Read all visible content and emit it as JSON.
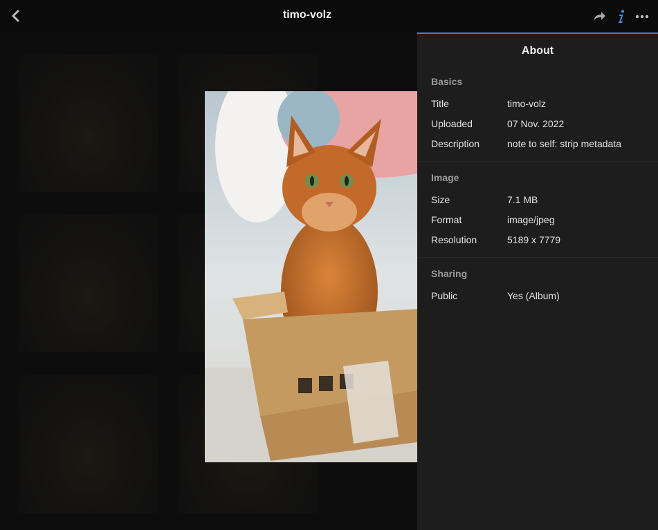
{
  "header": {
    "title": "timo-volz",
    "back_icon": "chevron-left-icon",
    "share_icon": "share-arrow-icon",
    "info_icon": "info-icon",
    "more_icon": "more-horizontal-icon"
  },
  "photo": {
    "subject": "orange cat sitting in cardboard box"
  },
  "panel": {
    "title": "About",
    "sections": [
      {
        "title": "Basics",
        "rows": [
          {
            "key": "Title",
            "value": "timo-volz"
          },
          {
            "key": "Uploaded",
            "value": "07 Nov. 2022"
          },
          {
            "key": "Description",
            "value": "note to self: strip metadata"
          }
        ]
      },
      {
        "title": "Image",
        "rows": [
          {
            "key": "Size",
            "value": "7.1 MB"
          },
          {
            "key": "Format",
            "value": "image/jpeg"
          },
          {
            "key": "Resolution",
            "value": "5189 x 7779"
          }
        ]
      },
      {
        "title": "Sharing",
        "rows": [
          {
            "key": "Public",
            "value": "Yes (Album)"
          }
        ]
      }
    ]
  },
  "colors": {
    "accent": "#3d7fd4",
    "panel_bg": "#1d1d1d",
    "header_bg": "#0b0b0b"
  }
}
